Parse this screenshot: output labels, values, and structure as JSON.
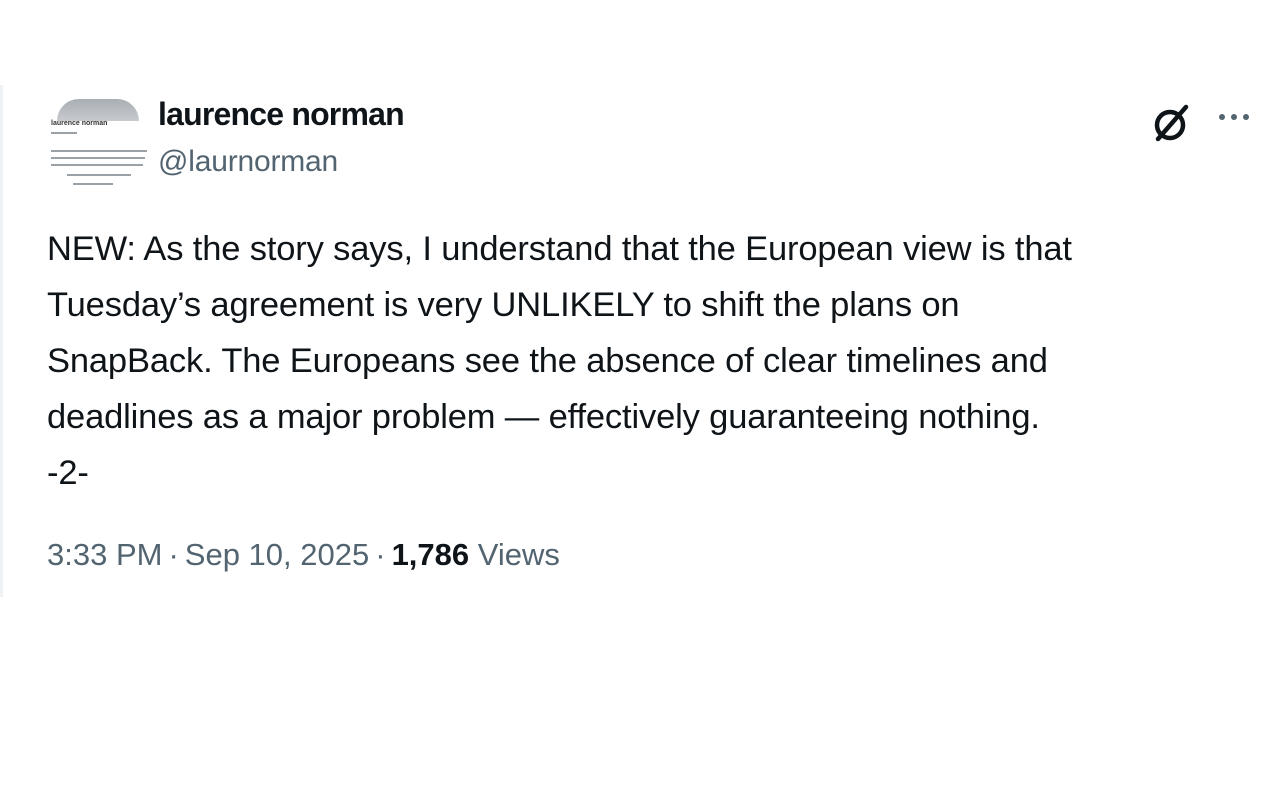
{
  "author": {
    "display_name": "laurence norman",
    "handle": "@laurnorman",
    "avatar_label": "laurence norman"
  },
  "icons": {
    "grok": "grok-icon",
    "more": "more-options-icon"
  },
  "tweet": {
    "text": "NEW: As the story says, I understand that the European view is that\nTuesday’s agreement is very UNLIKELY to shift the plans on\nSnapBack. The Europeans see the absence of clear timelines and\ndeadlines as a major problem — effectively guaranteeing nothing.\n-2-"
  },
  "meta": {
    "time": "3:33 PM",
    "separator": "·",
    "date": "Sep 10, 2025",
    "views_count": "1,786",
    "views_label": "Views"
  },
  "colors": {
    "text": "#0f1419",
    "secondary": "#536471"
  }
}
